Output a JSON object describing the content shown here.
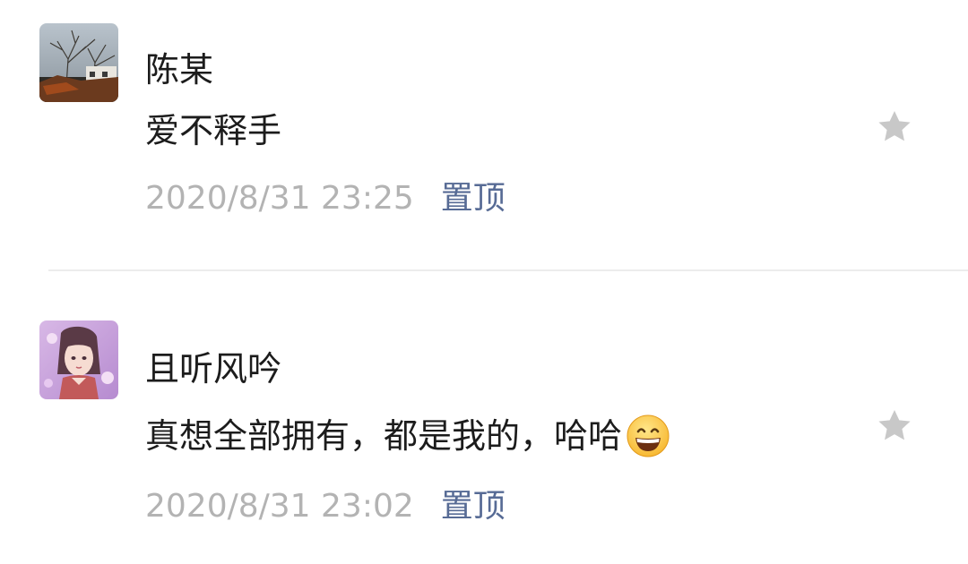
{
  "comments": [
    {
      "author": "陈某",
      "text": "爱不释手",
      "time": "2020/8/31 23:25",
      "pin_label": "置顶",
      "avatar_icon": "tree-landscape-avatar",
      "star_icon": "star-icon",
      "starred": false
    },
    {
      "author": "且听风吟",
      "text": "真想全部拥有，都是我的，哈哈",
      "emoji": "grinning-face-emoji",
      "time": "2020/8/31 23:02",
      "pin_label": "置顶",
      "avatar_icon": "anime-girl-avatar",
      "star_icon": "star-icon",
      "starred": false
    }
  ],
  "colors": {
    "text": "#1c1c1c",
    "timestamp": "#b3b3b3",
    "link": "#576b95",
    "star": "#c8c8c8",
    "divider": "#ececec"
  }
}
